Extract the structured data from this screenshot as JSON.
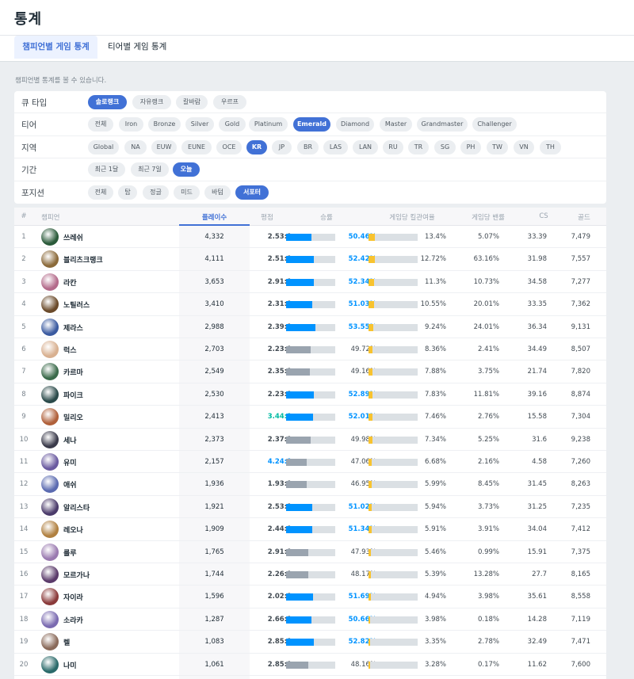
{
  "header": {
    "title": "통계"
  },
  "tabs": [
    {
      "label": "챔피언별 게임 통계",
      "active": true
    },
    {
      "label": "티어별 게임 통계",
      "active": false
    }
  ],
  "description": "챔피언별 통계를 볼 수 있습니다.",
  "filters": {
    "queue": {
      "label": "큐 타입",
      "options": [
        "솔로랭크",
        "자유랭크",
        "칼바람",
        "우르프"
      ],
      "selected": "솔로랭크"
    },
    "tier": {
      "label": "티어",
      "options": [
        "전체",
        "Iron",
        "Bronze",
        "Silver",
        "Gold",
        "Platinum",
        "Emerald",
        "Diamond",
        "Master",
        "Grandmaster",
        "Challenger"
      ],
      "selected": "Emerald"
    },
    "region": {
      "label": "지역",
      "options": [
        "Global",
        "NA",
        "EUW",
        "EUNE",
        "OCE",
        "KR",
        "JP",
        "BR",
        "LAS",
        "LAN",
        "RU",
        "TR",
        "SG",
        "PH",
        "TW",
        "VN",
        "TH"
      ],
      "selected": "KR"
    },
    "period": {
      "label": "기간",
      "options": [
        "최근 1달",
        "최근 7일",
        "오늘"
      ],
      "selected": "오늘"
    },
    "position": {
      "label": "포지션",
      "options": [
        "전체",
        "탑",
        "정글",
        "미드",
        "바텀",
        "서포터"
      ],
      "selected": "서포터"
    }
  },
  "table": {
    "columns": [
      "#",
      "챔피언",
      "플레이수",
      "평점",
      "승률",
      "게임당 킬관여율",
      "게임당 밴률",
      "CS",
      "골드"
    ],
    "headers": {
      "rank": "#",
      "champion": "챔피언",
      "plays": "플레이수",
      "kda": "평점",
      "winrate": "승률",
      "kp": "게임당 킬관여율",
      "ban": "게임당 밴률",
      "cs": "CS",
      "gold": "골드"
    },
    "sorted_by": "플레이수",
    "colors": {
      "blue_bar": "#0093ff",
      "gray_bar": "#9aa4af",
      "yellow_bar": "#f8c32f",
      "accent": "#4171d6"
    },
    "rows": [
      {
        "rank": "1",
        "name": "쓰레쉬",
        "plays": "4,332",
        "kda": "2.53:1",
        "winrate": "50.46%",
        "kp": "13.4%",
        "ban": "5.07%",
        "cs": "33.39",
        "gold": "7,479",
        "wr": 50.46,
        "kpv": 13.4,
        "av": "#2a5a3a"
      },
      {
        "rank": "2",
        "name": "블리츠크랭크",
        "plays": "4,111",
        "kda": "2.51:1",
        "winrate": "52.42%",
        "kp": "12.72%",
        "ban": "63.16%",
        "cs": "31.98",
        "gold": "7,557",
        "wr": 52.42,
        "kpv": 12.72,
        "av": "#8b6a3a"
      },
      {
        "rank": "3",
        "name": "라칸",
        "plays": "3,653",
        "kda": "2.91:1",
        "winrate": "52.34%",
        "kp": "11.3%",
        "ban": "10.73%",
        "cs": "34.58",
        "gold": "7,277",
        "wr": 52.34,
        "kpv": 11.3,
        "av": "#b36a8a"
      },
      {
        "rank": "4",
        "name": "노틸러스",
        "plays": "3,410",
        "kda": "2.31:1",
        "winrate": "51.03%",
        "kp": "10.55%",
        "ban": "20.01%",
        "cs": "33.35",
        "gold": "7,362",
        "wr": 51.03,
        "kpv": 10.55,
        "av": "#6a4a2a"
      },
      {
        "rank": "5",
        "name": "제라스",
        "plays": "2,988",
        "kda": "2.39:1",
        "winrate": "53.55%",
        "kp": "9.24%",
        "ban": "24.01%",
        "cs": "36.34",
        "gold": "9,131",
        "wr": 53.55,
        "kpv": 9.24,
        "av": "#3a5aa0"
      },
      {
        "rank": "6",
        "name": "럭스",
        "plays": "2,703",
        "kda": "2.23:1",
        "winrate": "49.72%",
        "kp": "8.36%",
        "ban": "2.41%",
        "cs": "34.49",
        "gold": "8,507",
        "wr": 49.72,
        "kpv": 8.36,
        "av": "#d8b090"
      },
      {
        "rank": "7",
        "name": "카르마",
        "plays": "2,549",
        "kda": "2.35:1",
        "winrate": "49.16%",
        "kp": "7.88%",
        "ban": "3.75%",
        "cs": "21.74",
        "gold": "7,820",
        "wr": 49.16,
        "kpv": 7.88,
        "av": "#3a6a4a"
      },
      {
        "rank": "8",
        "name": "파이크",
        "plays": "2,530",
        "kda": "2.23:1",
        "winrate": "52.89%",
        "kp": "7.83%",
        "ban": "11.81%",
        "cs": "39.16",
        "gold": "8,874",
        "wr": 52.89,
        "kpv": 7.83,
        "av": "#2a4a4a"
      },
      {
        "rank": "9",
        "name": "밀리오",
        "plays": "2,413",
        "kda": "3.44:1",
        "winrate": "52.01%",
        "kp": "7.46%",
        "ban": "2.76%",
        "cs": "15.58",
        "gold": "7,304",
        "wr": 52.01,
        "kpv": 7.46,
        "av": "#b0603a"
      },
      {
        "rank": "10",
        "name": "세나",
        "plays": "2,373",
        "kda": "2.37:1",
        "winrate": "49.98%",
        "kp": "7.34%",
        "ban": "5.25%",
        "cs": "31.6",
        "gold": "9,238",
        "wr": 49.98,
        "kpv": 7.34,
        "av": "#3a3a4a"
      },
      {
        "rank": "11",
        "name": "유미",
        "plays": "2,157",
        "kda": "4.24:1",
        "winrate": "47.06%",
        "kp": "6.68%",
        "ban": "2.16%",
        "cs": "4.58",
        "gold": "7,260",
        "wr": 47.06,
        "kpv": 6.68,
        "av": "#6a5aa0"
      },
      {
        "rank": "12",
        "name": "애쉬",
        "plays": "1,936",
        "kda": "1.93:1",
        "winrate": "46.95%",
        "kp": "5.99%",
        "ban": "8.45%",
        "cs": "31.45",
        "gold": "8,263",
        "wr": 46.95,
        "kpv": 5.99,
        "av": "#5a6ab0"
      },
      {
        "rank": "13",
        "name": "알리스타",
        "plays": "1,921",
        "kda": "2.53:1",
        "winrate": "51.02%",
        "kp": "5.94%",
        "ban": "3.73%",
        "cs": "31.25",
        "gold": "7,235",
        "wr": 51.02,
        "kpv": 5.94,
        "av": "#4a3a6a"
      },
      {
        "rank": "14",
        "name": "레오나",
        "plays": "1,909",
        "kda": "2.44:1",
        "winrate": "51.34%",
        "kp": "5.91%",
        "ban": "3.91%",
        "cs": "34.04",
        "gold": "7,412",
        "wr": 51.34,
        "kpv": 5.91,
        "av": "#b08040"
      },
      {
        "rank": "15",
        "name": "룰루",
        "plays": "1,765",
        "kda": "2.91:1",
        "winrate": "47.93%",
        "kp": "5.46%",
        "ban": "0.99%",
        "cs": "15.91",
        "gold": "7,375",
        "wr": 47.93,
        "kpv": 5.46,
        "av": "#9a7ab0"
      },
      {
        "rank": "16",
        "name": "모르가나",
        "plays": "1,744",
        "kda": "2.26:1",
        "winrate": "48.17%",
        "kp": "5.39%",
        "ban": "13.28%",
        "cs": "27.7",
        "gold": "8,165",
        "wr": 48.17,
        "kpv": 5.39,
        "av": "#5a3a6a"
      },
      {
        "rank": "17",
        "name": "자이라",
        "plays": "1,596",
        "kda": "2.02:1",
        "winrate": "51.69%",
        "kp": "4.94%",
        "ban": "3.98%",
        "cs": "35.61",
        "gold": "8,558",
        "wr": 51.69,
        "kpv": 4.94,
        "av": "#8a3a3a"
      },
      {
        "rank": "18",
        "name": "소라카",
        "plays": "1,287",
        "kda": "2.66:1",
        "winrate": "50.66%",
        "kp": "3.98%",
        "ban": "0.18%",
        "cs": "14.28",
        "gold": "7,119",
        "wr": 50.66,
        "kpv": 3.98,
        "av": "#7a6ab0"
      },
      {
        "rank": "19",
        "name": "렐",
        "plays": "1,083",
        "kda": "2.85:1",
        "winrate": "52.82%",
        "kp": "3.35%",
        "ban": "2.78%",
        "cs": "32.49",
        "gold": "7,471",
        "wr": 52.82,
        "kpv": 3.35,
        "av": "#8a6a5a"
      },
      {
        "rank": "20",
        "name": "나미",
        "plays": "1,061",
        "kda": "2.85:1",
        "winrate": "48.16%",
        "kp": "3.28%",
        "ban": "0.17%",
        "cs": "11.62",
        "gold": "7,600",
        "wr": 48.16,
        "kpv": 3.28,
        "av": "#2a6a6a"
      }
    ]
  }
}
